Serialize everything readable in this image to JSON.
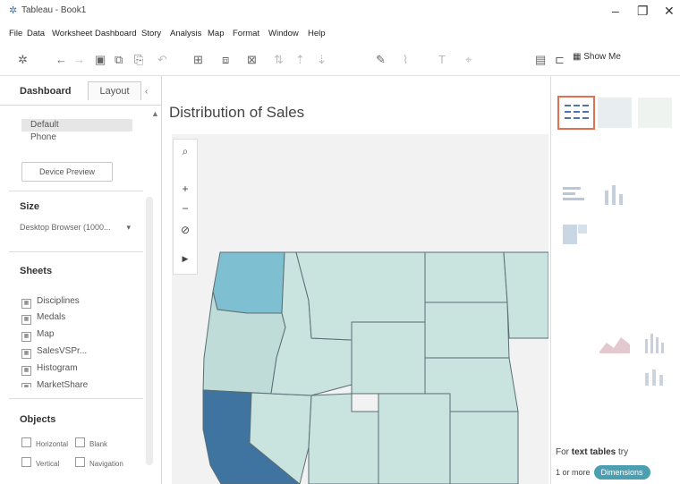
{
  "window": {
    "title": "Tableau - Book1",
    "minimize": "–",
    "maximize": "❐",
    "close": "✕"
  },
  "menu": [
    "File",
    "Data",
    "Worksheet",
    "Dashboard",
    "Story",
    "Analysis",
    "Map",
    "Format",
    "Window",
    "Help"
  ],
  "toolbar": {
    "show_me_label": "Show Me"
  },
  "left_panel": {
    "tabs": {
      "dashboard": "Dashboard",
      "layout": "Layout"
    },
    "devices": [
      "Default",
      "Phone"
    ],
    "device_preview_button": "Device Preview",
    "size_label": "Size",
    "size_value": "Desktop Browser (1000...",
    "sheets_label": "Sheets",
    "sheets": [
      "Disciplines",
      "Medals",
      "Map",
      "SalesVSPr...",
      "Histogram",
      "MarketShare"
    ],
    "objects_label": "Objects",
    "objects": [
      {
        "label": "Horizontal",
        "col": 0
      },
      {
        "label": "Blank",
        "col": 1
      },
      {
        "label": "Vertical",
        "col": 0
      },
      {
        "label": "Navigation",
        "col": 1
      }
    ]
  },
  "dashboard": {
    "title": "Distribution of Sales"
  },
  "map_colors": {
    "light": "#c9e3df",
    "light_alt": "#bfdcd8",
    "medium": "#7fbfd2",
    "dark": "#3f73a0",
    "border": "#5b6e74"
  },
  "show_me_panel": {
    "hint_prefix": "For",
    "hint_bold": "text tables",
    "hint_suffix": "try",
    "requirement": "1 or more",
    "pill": "Dimensions",
    "accent": "#4b9fb1",
    "selected_border": "#e07050"
  }
}
